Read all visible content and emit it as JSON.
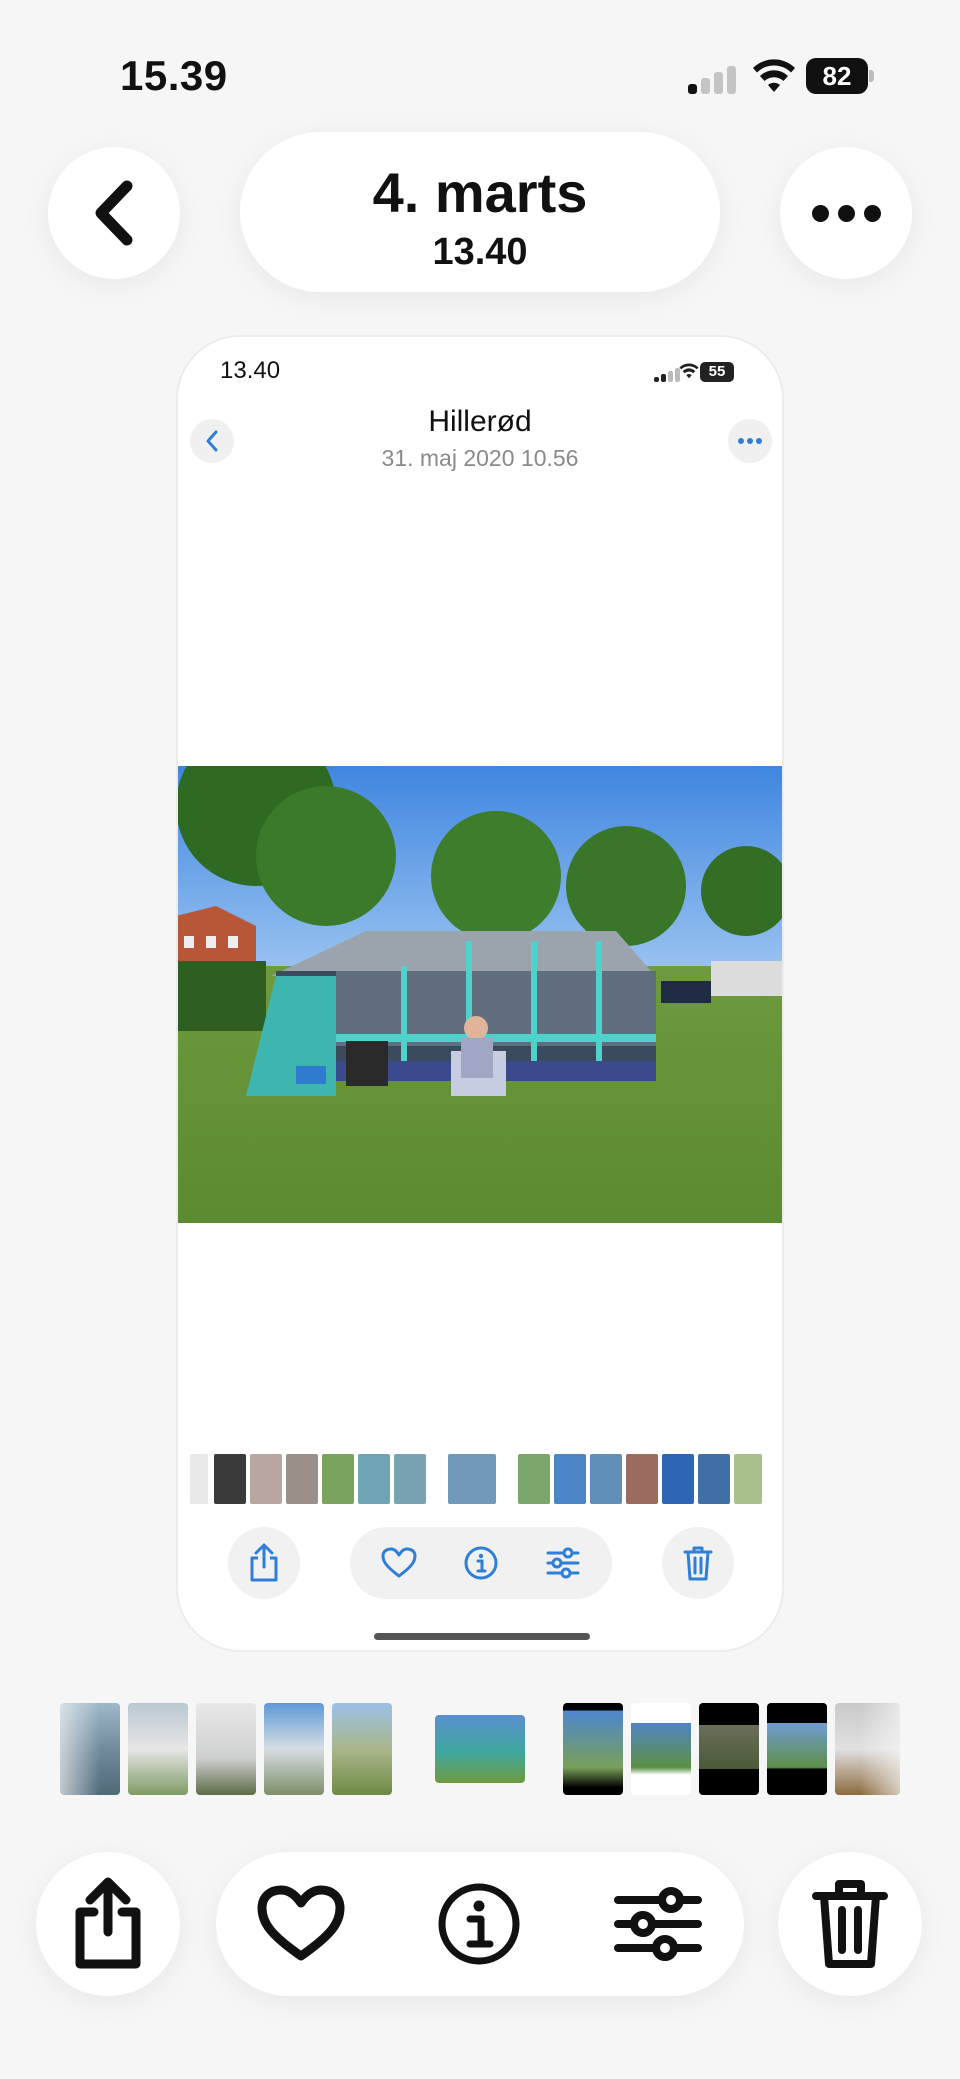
{
  "status_bar": {
    "time": "15.39",
    "battery": "82"
  },
  "header": {
    "title": "4. marts",
    "subtitle": "13.40"
  },
  "screenshot": {
    "status_bar": {
      "time": "13.40",
      "battery": "55"
    },
    "header": {
      "title": "Hillerød",
      "subtitle": "31. maj 2020  10.56"
    },
    "accent_color": "#2f7fd6"
  },
  "icons": {
    "back": "chevron-left-icon",
    "more": "ellipsis-icon",
    "share": "share-icon",
    "favorite": "heart-icon",
    "info": "info-icon",
    "adjust": "sliders-icon",
    "delete": "trash-icon"
  }
}
